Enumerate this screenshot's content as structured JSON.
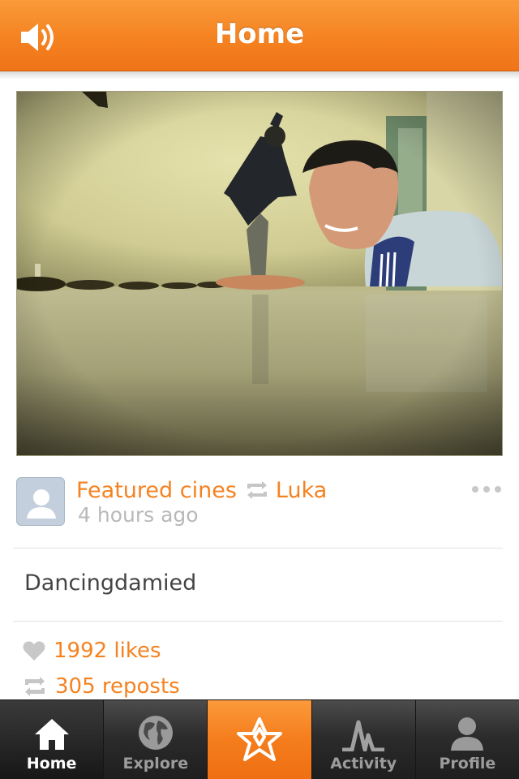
{
  "header": {
    "title": "Home",
    "sound_icon": "speaker-icon",
    "color": "#f58220"
  },
  "post": {
    "author": "Featured cines",
    "reposter": "Luka",
    "time": "4 hours ago",
    "caption": "Dancingdamied",
    "likes": "1992 likes",
    "reposts": "305 reposts",
    "more_icon": "more-dots-icon"
  },
  "tabs": [
    {
      "label": "Home",
      "icon": "home-icon",
      "active": true
    },
    {
      "label": "Explore",
      "icon": "globe-icon",
      "active": false
    },
    {
      "label": "",
      "icon": "camera-capture-icon",
      "active": false
    },
    {
      "label": "Activity",
      "icon": "activity-icon",
      "active": false
    },
    {
      "label": "Profile",
      "icon": "person-icon",
      "active": false
    }
  ],
  "colors": {
    "accent": "#f58220",
    "muted": "#b9b9b9",
    "tabbar": "#2c2c2c"
  }
}
